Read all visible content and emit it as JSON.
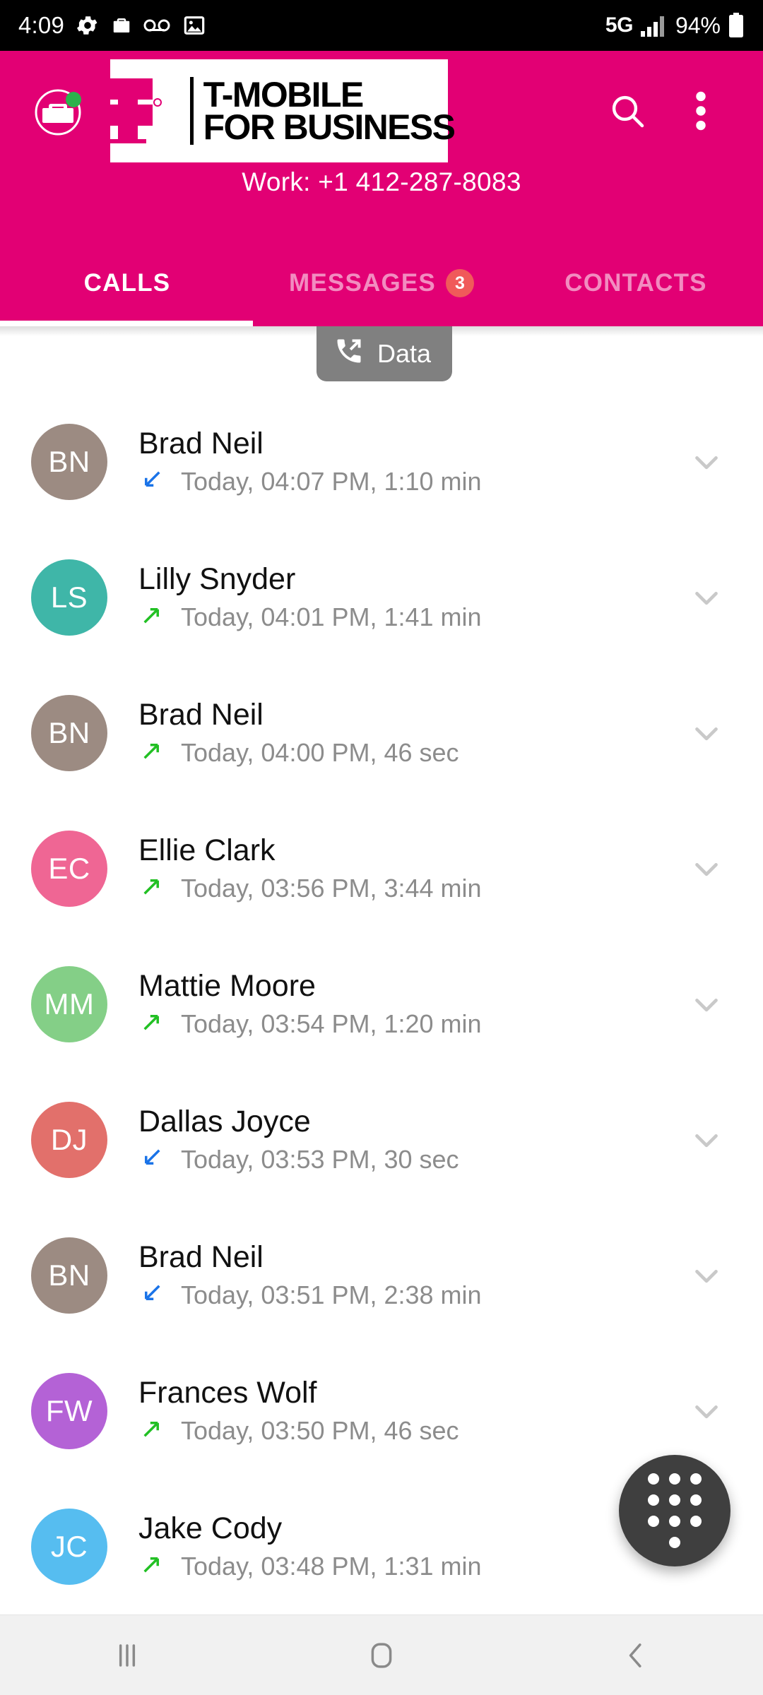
{
  "status_bar": {
    "time": "4:09",
    "icons": [
      "gear-icon",
      "briefcase-icon",
      "voicemail-icon",
      "image-icon"
    ],
    "network": "5G",
    "signal_icon": "signal-bars-icon",
    "battery": "94%",
    "battery_icon": "battery-icon"
  },
  "header": {
    "background_color": "#e20074",
    "business_badge_icon": "briefcase-badge-icon",
    "business_badge_dot_color": "#2bb24c",
    "logo": {
      "mark": "t-mobile-t-icon",
      "line1": "T-MOBILE",
      "line2": "FOR BUSINESS"
    },
    "search_icon": "search-icon",
    "overflow_icon": "more-vertical-icon",
    "work_number": "Work: +1 412-287-8083",
    "tabs": [
      {
        "label": "CALLS",
        "active": true,
        "badge": ""
      },
      {
        "label": "MESSAGES",
        "active": false,
        "badge": "3"
      },
      {
        "label": "CONTACTS",
        "active": false,
        "badge": ""
      }
    ],
    "badge_color": "#f05a5a"
  },
  "content": {
    "data_chip": {
      "label": "Data",
      "icon": "outgoing-call-icon",
      "background": "#808080"
    },
    "call_direction_colors": {
      "incoming": "#1a73e8",
      "outgoing": "#22c024"
    },
    "calls": [
      {
        "initials": "BN",
        "name": "Brad Neil",
        "meta": "Today, 04:07 PM,  1:10 min",
        "direction": "incoming",
        "avatar_color": "#9c8b82"
      },
      {
        "initials": "LS",
        "name": "Lilly Snyder",
        "meta": "Today, 04:01 PM,  1:41 min",
        "direction": "outgoing",
        "avatar_color": "#3fb6a8"
      },
      {
        "initials": "BN",
        "name": "Brad Neil",
        "meta": "Today, 04:00 PM,  46 sec",
        "direction": "outgoing",
        "avatar_color": "#9c8b82"
      },
      {
        "initials": "EC",
        "name": "Ellie Clark",
        "meta": "Today, 03:56 PM,  3:44 min",
        "direction": "outgoing",
        "avatar_color": "#ef6694"
      },
      {
        "initials": "MM",
        "name": "Mattie Moore",
        "meta": "Today, 03:54 PM,  1:20 min",
        "direction": "outgoing",
        "avatar_color": "#84cf87"
      },
      {
        "initials": "DJ",
        "name": "Dallas Joyce",
        "meta": "Today, 03:53 PM,  30 sec",
        "direction": "incoming",
        "avatar_color": "#e2706b"
      },
      {
        "initials": "BN",
        "name": "Brad Neil",
        "meta": "Today, 03:51 PM,  2:38 min",
        "direction": "incoming",
        "avatar_color": "#9c8b82"
      },
      {
        "initials": "FW",
        "name": "Frances Wolf",
        "meta": "Today, 03:50 PM,  46 sec",
        "direction": "outgoing",
        "avatar_color": "#b462d6"
      },
      {
        "initials": "JC",
        "name": "Jake Cody",
        "meta": "Today, 03:48 PM,  1:31 min",
        "direction": "outgoing",
        "avatar_color": "#56bdf0"
      }
    ],
    "row_expand_icon": "chevron-down-icon"
  },
  "fab": {
    "icon": "dialpad-icon",
    "background": "#3f3f3f"
  },
  "navbar": {
    "buttons": [
      {
        "icon": "recents-icon",
        "name": "recents"
      },
      {
        "icon": "home-icon",
        "name": "home"
      },
      {
        "icon": "back-icon",
        "name": "back"
      }
    ]
  }
}
